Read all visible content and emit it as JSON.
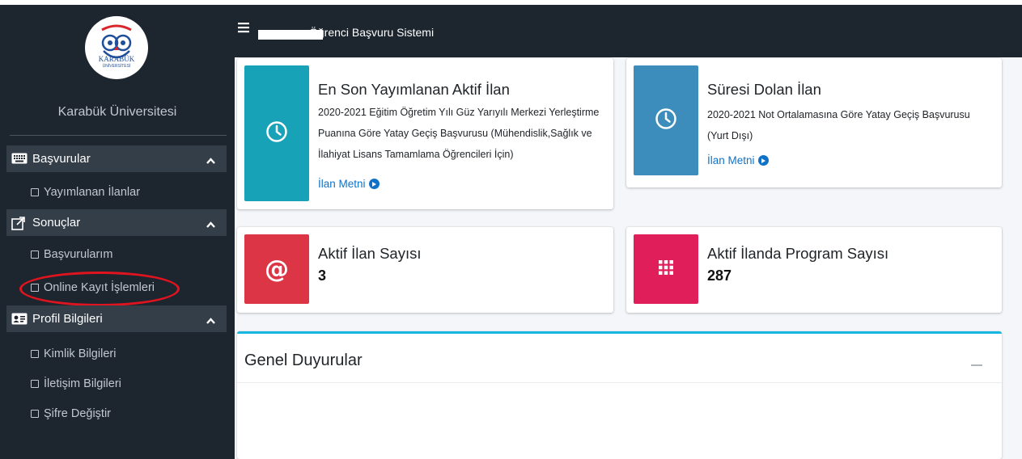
{
  "app": {
    "title": "Öğrenci Başvuru Sistemi"
  },
  "sidebar": {
    "logo_text": "KARABÜK",
    "logo_subtext": "ÜNİVERSİTESİ",
    "org_name": "Karabük Üniversitesi",
    "sections": [
      {
        "label": "Başvurular",
        "icon": "keyboard-icon",
        "items": [
          "Yayımlanan İlanlar"
        ]
      },
      {
        "label": "Sonuçlar",
        "icon": "external-link-icon",
        "items": [
          "Başvurularım",
          "Online Kayıt İşlemleri"
        ]
      },
      {
        "label": "Profil Bilgileri",
        "icon": "id-card-icon",
        "items": [
          "Kimlik Bilgileri",
          "İletişim Bilgileri",
          "Şifre Değiştir"
        ]
      }
    ],
    "highlighted_item": "Online Kayıt İşlemleri"
  },
  "cards": {
    "latest": {
      "title": "En Son Yayımlanan Aktif İlan",
      "lines": [
        "2020-2021 Eğitim Öğretim Yılı Güz Yarıyılı Merkezi Yerleştirme",
        "Puanına Göre Yatay Geçiş Başvurusu (Mühendislik,Sağlık ve",
        "İlahiyat Lisans Tamamlama Öğrencileri İçin)"
      ],
      "link": "İlan Metni",
      "icon": "clock-icon",
      "color": "#17a2b8"
    },
    "expired": {
      "title": "Süresi Dolan İlan",
      "lines": [
        "2020-2021 Not Ortalamasına Göre Yatay Geçiş Başvurusu",
        "(Yurt Dışı)"
      ],
      "link": "İlan Metni",
      "icon": "clock-icon",
      "color": "#3c8dbc"
    },
    "active_count": {
      "title": "Aktif İlan Sayısı",
      "value": "3",
      "icon": "at-sign-icon",
      "color": "#dc3545"
    },
    "program_count": {
      "title": "Aktif İlanda Program Sayısı",
      "value": "287",
      "icon": "grid-icon",
      "color": "#e01e5a"
    }
  },
  "panel": {
    "title": "Genel Duyurular"
  },
  "colors": {
    "sidebar_bg": "#1d252f",
    "panel_accent": "#17b6e0",
    "highlight": "#e0141e"
  }
}
